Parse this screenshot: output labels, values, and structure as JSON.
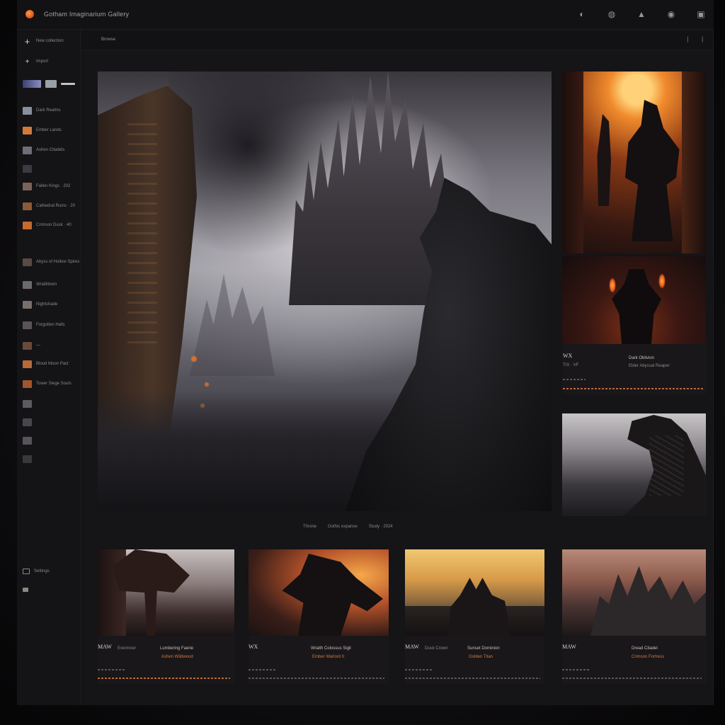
{
  "window": {
    "title": "Gotham Imaginarium Gallery",
    "top_icons": [
      {
        "name": "theme-icon",
        "glyph": "◐"
      },
      {
        "name": "globe-icon",
        "glyph": "◍"
      },
      {
        "name": "brush-icon",
        "glyph": "▲"
      },
      {
        "name": "user-icon",
        "glyph": "◉"
      },
      {
        "name": "bookmark-icon",
        "glyph": "▣"
      }
    ]
  },
  "sidebar": {
    "new_label": "New collection",
    "add_label": "Import",
    "items": [
      {
        "label": "Dark Realms",
        "color": "#8a8f9c"
      },
      {
        "label": "Ember Lands",
        "color": "#d27a3c"
      },
      {
        "label": "Ashen Citadels",
        "color": "#6f6e78"
      },
      {
        "label": "",
        "color": "#3c3a40"
      },
      {
        "label": "Fallen Kings · 202",
        "color": "#7a6358"
      },
      {
        "label": "Cathedral Ruins · 20",
        "color": "#8c5a3a"
      },
      {
        "label": "Crimson Dusk · 40",
        "color": "#c66a30"
      },
      {
        "label": "Abyss of Hollow Spires",
        "color": "#5a4a44"
      },
      {
        "label": "Wraithborn",
        "color": "#6e6a6a"
      },
      {
        "label": "Nightshade",
        "color": "#7a6e6a"
      },
      {
        "label": "Forgotten Halls",
        "color": "#5a5458"
      },
      {
        "label": "—",
        "color": "#6a4a3a"
      },
      {
        "label": "Blood Moon Pact",
        "color": "#b8693a"
      },
      {
        "label": "Tower Siege Souls",
        "color": "#a0552c"
      },
      {
        "label": "",
        "color": "#5d5a60"
      },
      {
        "label": "",
        "color": "#4a474c"
      },
      {
        "label": "",
        "color": "#58545a"
      },
      {
        "label": "",
        "color": "#3a383c"
      }
    ],
    "footer": [
      {
        "label": "Settings"
      },
      {
        "label": ""
      }
    ]
  },
  "subheader": {
    "breadcrumb": "Browse"
  },
  "hero": {
    "caption_parts": [
      "Throne",
      "Gothic expanse",
      "Study · 2024"
    ]
  },
  "right_card": {
    "title": "WX",
    "subtitle": "TIX · VF",
    "author": "Dark Oblivion",
    "author_sub": "Elder Abyssal Reaper"
  },
  "bottom_cards": [
    {
      "title": "MAW",
      "subtitle": "Evermoor",
      "col2": "Lumbering Faerie",
      "col2_orange": "Ashen Wildwood"
    },
    {
      "title": "WX",
      "subtitle": "",
      "col2": "Wraith Colossus Sigil",
      "col2_orange": "Ember Warlord II"
    },
    {
      "title": "MAW",
      "subtitle": "Dusk Crown",
      "col2": "Sunset Dominion",
      "col2_orange": "Golden Titan"
    },
    {
      "title": "MAW",
      "subtitle": "",
      "col2": "Dread Citadel",
      "col2_orange": "Crimson Fortress"
    }
  ],
  "colors": {
    "accent": "#e25a1c",
    "orange_text": "#d27a3c",
    "bg": "#151417"
  }
}
